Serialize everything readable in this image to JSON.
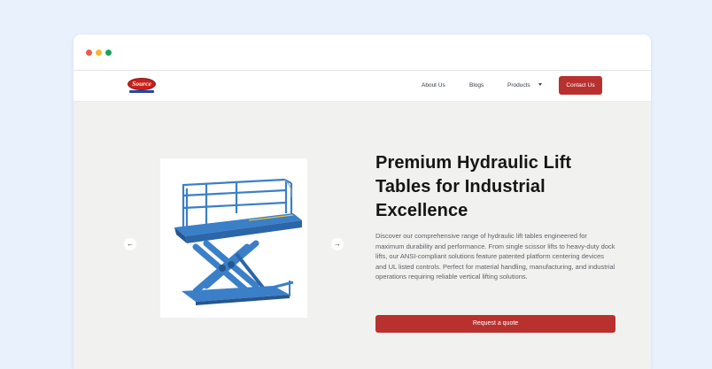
{
  "brand": {
    "logo_text": "Source"
  },
  "nav": {
    "about": "About Us",
    "blogs": "Blogs",
    "products": "Products",
    "contact": "Contact Us"
  },
  "hero": {
    "title": "Premium Hydraulic Lift Tables for Industrial Excellence",
    "description": "Discover our comprehensive range of hydraulic lift tables engineered for maximum durability and performance. From single scissor lifts to heavy-duty dock lifts, our ANSI-compliant solutions feature patented platform centering devices and UL listed controls. Perfect for material handling, manufacturing, and industrial operations requiring reliable vertical lifting solutions.",
    "cta": "Request a quote",
    "prev_icon": "←",
    "next_icon": "→"
  },
  "colors": {
    "accent": "#b8312f",
    "page_bg": "#e9f1fd",
    "hero_bg": "#f1f1ef",
    "lift_blue": "#3a7fc8"
  }
}
